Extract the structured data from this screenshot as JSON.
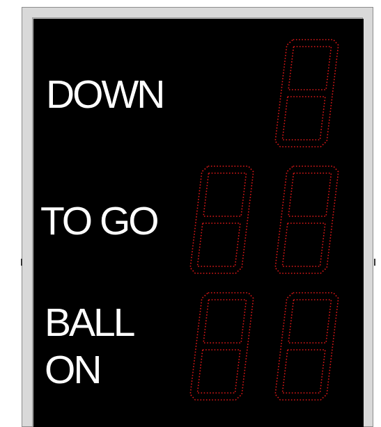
{
  "scoreboard": {
    "labels": {
      "down": "DOWN",
      "to_go": "TO GO",
      "ball_on_line1": "BALL",
      "ball_on_line2": "ON"
    },
    "colors": {
      "panel": "#000000",
      "frame": "#d9d9d9",
      "label_text": "#ffffff",
      "led_segment": "#e01818"
    },
    "digits": {
      "down": [
        "",
        ""
      ],
      "to_go": [
        "",
        ""
      ],
      "ball_on": [
        "",
        ""
      ]
    },
    "led_display_state": "unlit-outline"
  }
}
